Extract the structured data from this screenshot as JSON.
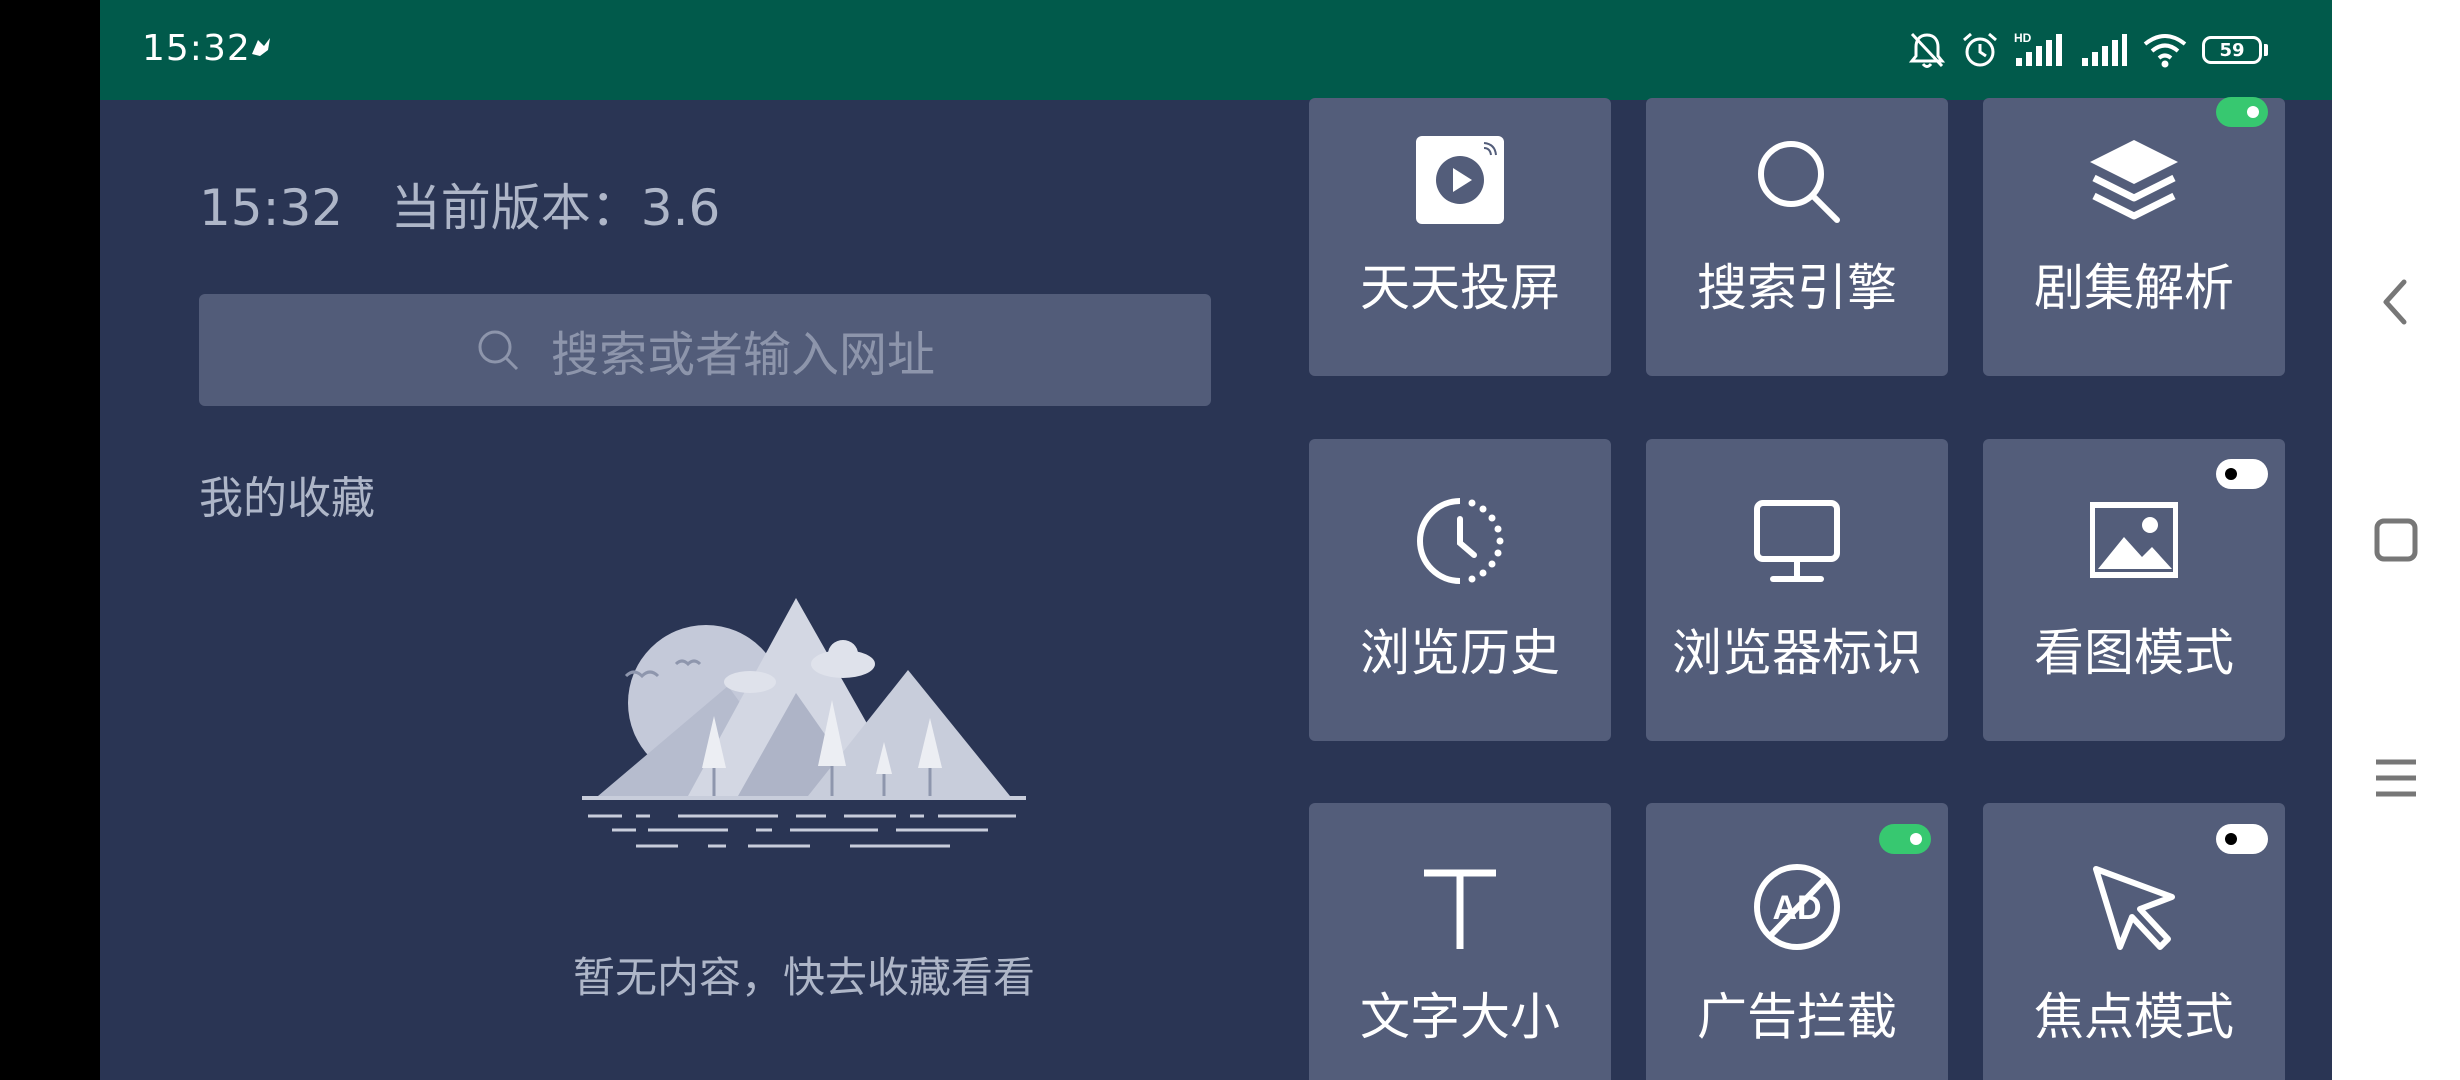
{
  "status_bar": {
    "time": "15:32",
    "battery": "59",
    "icons": [
      "app-notification-icon",
      "mute-bell-icon",
      "alarm-icon",
      "hd-signal-icon",
      "signal-icon",
      "wifi-icon",
      "battery-icon"
    ],
    "color": "#015a4b"
  },
  "header": {
    "time": "15:32",
    "version_label": "当前版本：3.6"
  },
  "search": {
    "placeholder": "搜索或者输入网址"
  },
  "favorites": {
    "title": "我的收藏",
    "empty_text": "暂无内容，快去收藏看看"
  },
  "tiles": [
    {
      "label": "天天投屏",
      "icon": "cast-play-icon"
    },
    {
      "label": "搜索引擎",
      "icon": "search-icon"
    },
    {
      "label": "剧集解析",
      "icon": "layers-icon",
      "toggle": "on"
    },
    {
      "label": "浏览历史",
      "icon": "history-clock-icon"
    },
    {
      "label": "浏览器标识",
      "icon": "monitor-icon"
    },
    {
      "label": "看图模式",
      "icon": "image-icon",
      "toggle": "off"
    },
    {
      "label": "文字大小",
      "icon": "text-size-icon"
    },
    {
      "label": "广告拦截",
      "icon": "ad-block-icon",
      "toggle": "on"
    },
    {
      "label": "焦点模式",
      "icon": "cursor-icon",
      "toggle": "off"
    }
  ],
  "colors": {
    "background": "#2a3554",
    "tile": "#535d7a",
    "toggle_on": "#37c870"
  },
  "nav_bar": {
    "buttons": [
      "back-icon",
      "recents-square-icon",
      "menu-icon"
    ]
  }
}
